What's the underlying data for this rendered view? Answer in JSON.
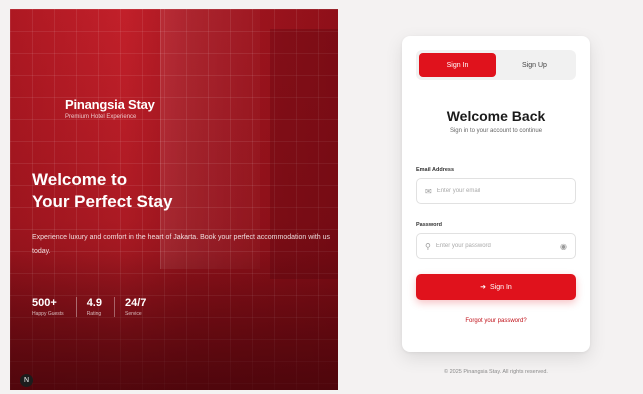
{
  "hero": {
    "brand_name": "Pinangsia Stay",
    "brand_tagline": "Premium Hotel Experience",
    "headline_line1": "Welcome to",
    "headline_line2": "Your Perfect Stay",
    "description": "Experience luxury and comfort in the heart of Jakarta. Book your perfect accommodation with us today.",
    "stats": [
      {
        "value": "500+",
        "label": "Happy Guests"
      },
      {
        "value": "4.9",
        "label": "Rating"
      },
      {
        "value": "24/7",
        "label": "Service"
      }
    ],
    "corner_icon": "N"
  },
  "auth": {
    "tabs": [
      {
        "label": "Sign In",
        "active": true
      },
      {
        "label": "Sign Up",
        "active": false
      }
    ],
    "title": "Welcome Back",
    "subtitle": "Sign in to your account to continue",
    "email_label": "Email Address",
    "email_placeholder": "Enter your email",
    "password_label": "Password",
    "password_placeholder": "Enter your password",
    "submit_label": "Sign In",
    "forgot_label": "Forgot your password?"
  },
  "footer": {
    "text": "© 2025 Pinangsia Stay. All rights reserved."
  },
  "icons": {
    "email": "mail-icon",
    "password": "lock-icon",
    "toggle": "eye-icon",
    "submit": "login-icon"
  },
  "colors": {
    "accent": "#e0121c",
    "hero_base": "#b01a24"
  }
}
